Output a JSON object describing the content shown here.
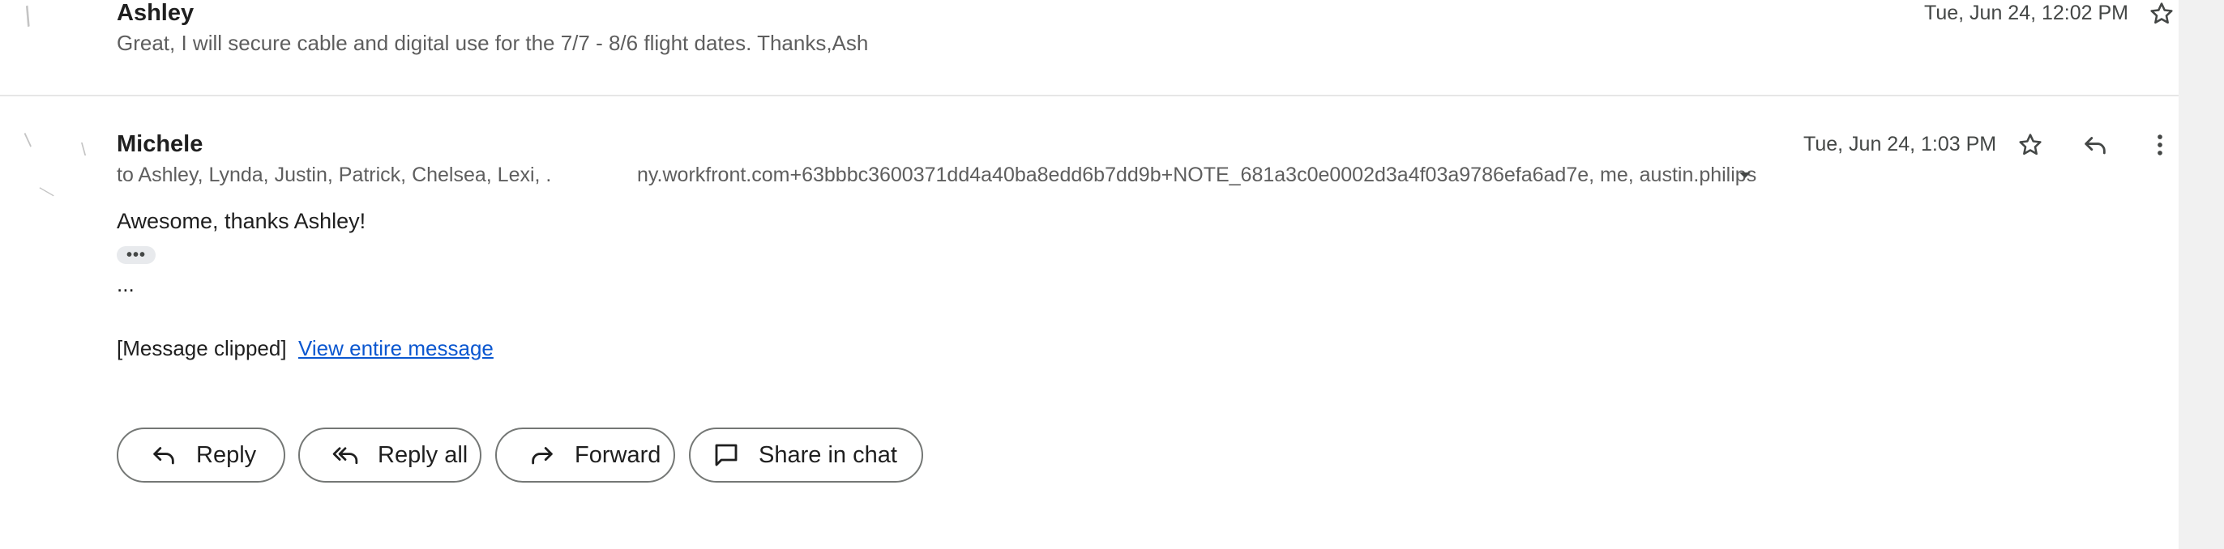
{
  "messages": [
    {
      "sender": "Ashley",
      "snippet": "Great, I will secure cable and digital use for the 7/7 - 8/6 flight dates. Thanks,Ash",
      "date": "Tue, Jun 24, 12:02 PM"
    },
    {
      "sender": "Michele",
      "recipients_head": "to Ashley, Lynda, Justin, Patrick, Chelsea, Lexi, .",
      "recipients_tail": "ny.workfront.com+63bbbc3600371dd4a40ba8edd6b7dd9b+NOTE_681a3c0e0002d3a4f03a9786efa6ad7e, me, austin.philips",
      "date": "Tue, Jun 24, 1:03 PM",
      "body": "Awesome, thanks Ashley!",
      "ellipsis_chip": "•••",
      "trailing": "...",
      "clipped_notice": "[Message clipped]",
      "view_link": "View entire message"
    }
  ],
  "actions": {
    "reply": "Reply",
    "reply_all": "Reply all",
    "forward": "Forward",
    "share_chat": "Share in chat"
  },
  "icons": [
    "star-icon",
    "reply-icon",
    "more-vert-icon",
    "chevron-down-icon",
    "reply-all-icon",
    "forward-icon",
    "chat-icon"
  ],
  "colors": {
    "link": "#0b57d0",
    "muted": "#5e5e5e",
    "border": "#747775"
  }
}
